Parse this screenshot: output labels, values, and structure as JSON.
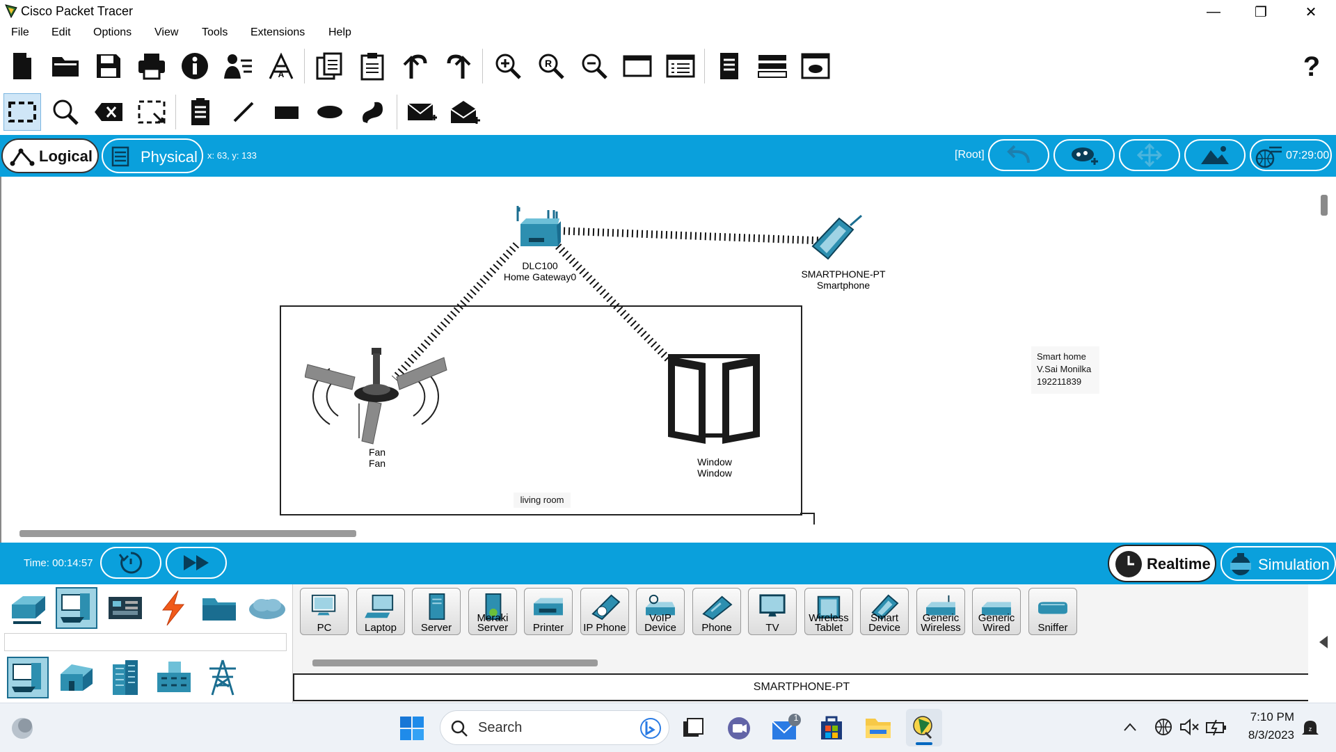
{
  "window": {
    "title": "Cisco Packet Tracer",
    "minimize": "—",
    "maximize": "❐",
    "close": "✕"
  },
  "menu": [
    "File",
    "Edit",
    "Options",
    "View",
    "Tools",
    "Extensions",
    "Help"
  ],
  "toolbar1": [
    "new-file",
    "open-folder",
    "save",
    "print",
    "info",
    "network-wizard",
    "activity-wizard",
    "copy",
    "paste",
    "undo",
    "redo",
    "zoom-in",
    "zoom-reset",
    "zoom-out",
    "drawing-palette",
    "custom-device-dialog",
    "pdu-list",
    "cluster",
    "viewport",
    "help"
  ],
  "toolbar2": [
    "select",
    "inspect",
    "delete",
    "resize",
    "note",
    "line",
    "rectangle",
    "ellipse",
    "freeform",
    "add-simple-pdu",
    "add-complex-pdu"
  ],
  "modebar": {
    "logical": "Logical",
    "physical": "Physical",
    "coords": "x: 63, y: 133",
    "root": "[Root]",
    "clock": "07:29:00"
  },
  "canvas": {
    "gateway": {
      "model": "DLC100",
      "name": "Home Gateway0"
    },
    "smartphone": {
      "model": "SMARTPHONE-PT",
      "name": "Smartphone"
    },
    "fan": {
      "model": "Fan",
      "name": "Fan"
    },
    "window_dev": {
      "model": "Window",
      "name": "Window"
    },
    "room_label": "living room",
    "note": {
      "line1": "Smart home",
      "line2": "V.Sai Monilka",
      "line3": "192211839"
    }
  },
  "timebar": {
    "time": "Time: 00:14:57",
    "realtime": "Realtime",
    "simulation": "Simulation"
  },
  "devices": [
    {
      "label": "PC",
      "icon": "pc-icon"
    },
    {
      "label": "Laptop",
      "icon": "laptop-icon"
    },
    {
      "label": "Server",
      "icon": "server-icon"
    },
    {
      "label": "Meraki Server",
      "icon": "meraki-server-icon"
    },
    {
      "label": "Printer",
      "icon": "printer-icon"
    },
    {
      "label": "IP Phone",
      "icon": "ip-phone-icon"
    },
    {
      "label": "VoIP Device",
      "icon": "voip-icon"
    },
    {
      "label": "Phone",
      "icon": "phone-icon"
    },
    {
      "label": "TV",
      "icon": "tv-icon"
    },
    {
      "label": "Wireless Tablet",
      "icon": "tablet-icon"
    },
    {
      "label": "Smart Device",
      "icon": "smart-device-icon"
    },
    {
      "label": "Generic Wireless",
      "icon": "generic-wireless-icon"
    },
    {
      "label": "Generic Wired",
      "icon": "generic-wired-icon"
    },
    {
      "label": "Sniffer",
      "icon": "sniffer-icon"
    }
  ],
  "selected_device": "SMARTPHONE-PT",
  "taskbar": {
    "search": "Search",
    "mail_badge": "1",
    "time": "7:10 PM",
    "date": "8/3/2023"
  },
  "colors": {
    "accent": "#0aa0dc",
    "device_teal": "#2d8fb0",
    "link": "#000000"
  }
}
